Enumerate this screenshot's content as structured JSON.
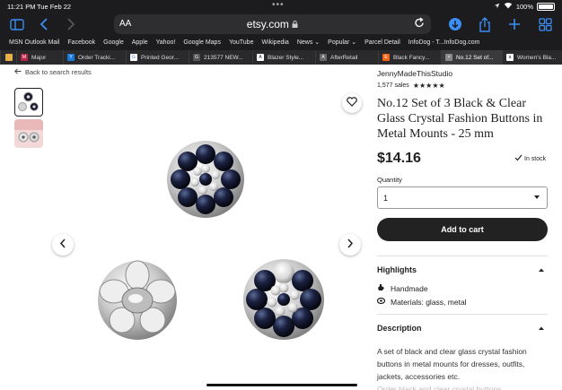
{
  "status_bar": {
    "time": "11:21 PM",
    "date": "Tue Feb 22",
    "battery": "100%"
  },
  "address_bar": {
    "aa": "AA",
    "url": "etsy.com"
  },
  "bookmarks": [
    "MSN Outlook Mail",
    "Facebook",
    "Google",
    "Apple",
    "Yahoo!",
    "Google Maps",
    "YouTube",
    "Wikipedia",
    "News ⌄",
    "Popular ⌄",
    "Parcel Detail",
    "InfoDog - T...InfoDog.com"
  ],
  "tabs": [
    {
      "label": "Major",
      "color": "#b8264a",
      "glyph": "M"
    },
    {
      "label": "Order Tracki...",
      "color": "#1a7ad9",
      "glyph": "Y"
    },
    {
      "label": "Printed Geor...",
      "color": "#ffffff",
      "glyph": "G"
    },
    {
      "label": "213577 NEW...",
      "color": "#555555",
      "glyph": "G"
    },
    {
      "label": "Blazer Style...",
      "color": "#ffffff",
      "glyph": "A"
    },
    {
      "label": "AfterRetail",
      "color": "#666666",
      "glyph": "A"
    },
    {
      "label": "Black Fancy...",
      "color": "#f1641e",
      "glyph": "E"
    },
    {
      "label": "No.12 Set of...",
      "color": "#888888",
      "glyph": "×"
    },
    {
      "label": "Women's Bla...",
      "color": "#ffffff",
      "glyph": "a"
    }
  ],
  "back_link": "Back to search results",
  "product": {
    "shop_name": "JennyMadeThisStudio",
    "sales": "1,577 sales",
    "rating": 5,
    "stars": "★★★★★",
    "title": "No.12 Set of 3 Black & Clear Glass Crystal Fashion Buttons in Metal Mounts - 25 mm",
    "price": "$14.16",
    "stock": "In stock",
    "quantity_label": "Quantity",
    "quantity_value": "1",
    "add_to_cart": "Add to cart"
  },
  "highlights": {
    "title": "Highlights",
    "items": [
      "Handmade",
      "Materials: glass, metal"
    ]
  },
  "description": {
    "title": "Description",
    "text": "A set of black and clear glass crystal fashion buttons in metal mounts for dresses, outfits, jackets, accessories etc.",
    "truncated": "Order black and clear crystal buttons..."
  },
  "colors": {
    "accent_dark": "#222222",
    "safari_blue": "#3a8ef5",
    "chrome_bg": "#1c1c1e"
  }
}
